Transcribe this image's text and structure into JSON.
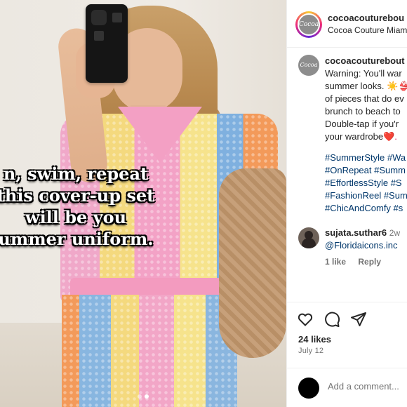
{
  "post": {
    "overlay_lines": [
      "n, swim, repeat",
      "this cover-up set",
      "will be you",
      "ummer uniform."
    ],
    "carousel_dots": 2,
    "active_dot": 1
  },
  "header": {
    "avatar_text": "Cocoa",
    "username": "cocoacouturebou",
    "location": "Cocoa Couture Miam"
  },
  "caption": {
    "avatar_text": "Cocoa",
    "username": "cocoacouturebout",
    "lines": [
      "Warning: You'll war",
      "summer looks. ☀️👙",
      "of pieces that do ev",
      "brunch to beach to",
      "Double-tap if you'r"
    ],
    "last_line_text": "your wardrobe",
    "last_line_emoji": "❤️.",
    "hashtags": [
      "#SummerStyle #Wa",
      "#OnRepeat #Summ",
      "#EffortlessStyle #S",
      "#FashionReel #Sum",
      "#ChicAndComfy #s"
    ]
  },
  "comment": {
    "username": "sujata.suthar6",
    "time": "2w",
    "mention": "@Floridaicons.inc",
    "likes": "1 like",
    "reply": "Reply"
  },
  "actions": {
    "icons": [
      "heart-icon",
      "comment-icon",
      "share-icon"
    ],
    "likes": "24 likes",
    "date": "July 12"
  },
  "add_comment": {
    "placeholder": "Add a comment..."
  },
  "colors": {
    "link": "#00376b",
    "muted": "#737373",
    "heart": "#e0245e"
  }
}
